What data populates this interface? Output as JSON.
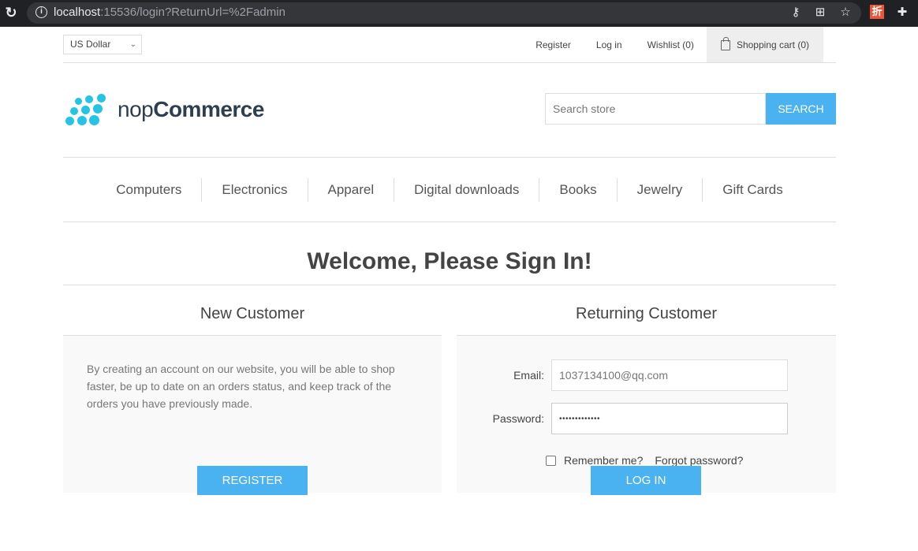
{
  "browser": {
    "url_host": "localhost",
    "url_rest": ":15536/login?ReturnUrl=%2Fadmin",
    "icons": [
      "reload-icon",
      "info-icon",
      "key-icon",
      "translate-icon",
      "star-icon",
      "extension-discount-icon",
      "extensions-puzzle-icon"
    ],
    "ext_glyph": "折"
  },
  "header": {
    "currency": "US Dollar",
    "links": {
      "register": "Register",
      "login": "Log in",
      "wishlist": "Wishlist (0)",
      "cart": "Shopping cart (0)"
    }
  },
  "logo": {
    "light": "nop",
    "bold": "Commerce"
  },
  "search": {
    "placeholder": "Search store",
    "button": "SEARCH"
  },
  "menu": [
    "Computers",
    "Electronics",
    "Apparel",
    "Digital downloads",
    "Books",
    "Jewelry",
    "Gift Cards"
  ],
  "page": {
    "title": "Welcome, Please Sign In!",
    "new_customer": {
      "heading": "New Customer",
      "text": "By creating an account on our website, you will be able to shop faster, be up to date on an orders status, and keep track of the orders you have previously made.",
      "button": "REGISTER"
    },
    "returning_customer": {
      "heading": "Returning Customer",
      "email_label": "Email:",
      "email_value": "1037134100@qq.com",
      "password_label": "Password:",
      "password_value": "•••••••••••••",
      "remember_label": "Remember me?",
      "remember_checked": false,
      "forgot_label": "Forgot password?",
      "button": "LOG IN"
    }
  },
  "colors": {
    "accent": "#4ab2f1",
    "logo": "#25c4e4",
    "panel": "#f9f9f9"
  }
}
